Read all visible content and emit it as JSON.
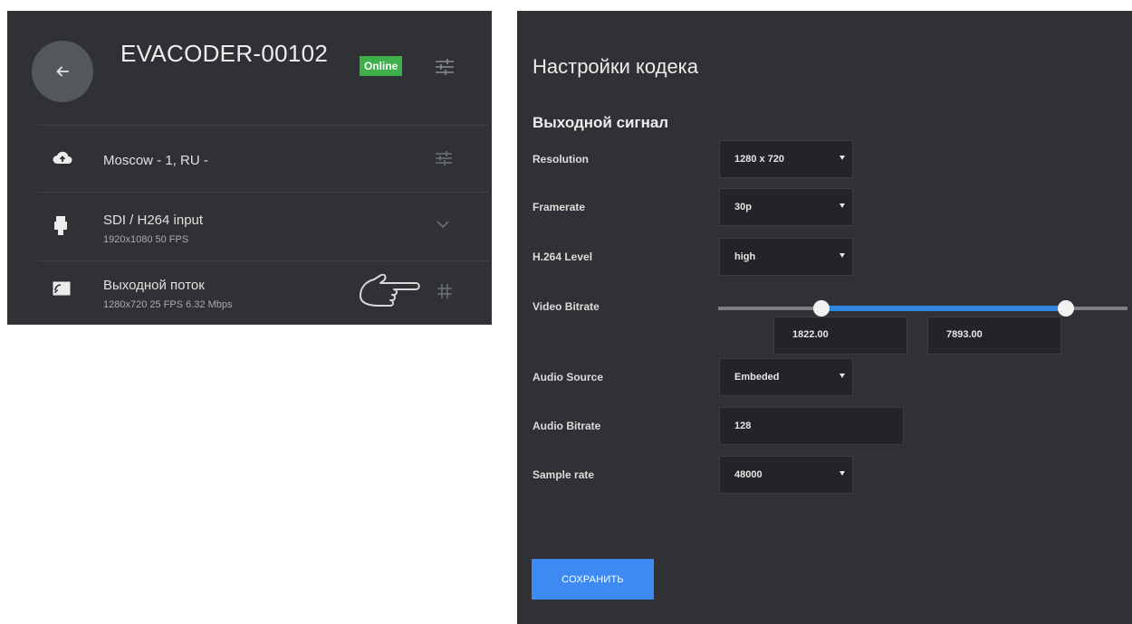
{
  "device": {
    "title": "EVACODER-00102",
    "status": "Online",
    "status_color": "#3db04b"
  },
  "rows": [
    {
      "icon": "cloud-upload-icon",
      "label": "Moscow - 1, RU  -",
      "sub": ""
    },
    {
      "icon": "sdi-connector-icon",
      "label": "SDI / H264 input",
      "sub": "1920x1080 50 FPS"
    },
    {
      "icon": "cast-icon",
      "label": "Выходной поток",
      "sub": "1280x720 25 FPS 6.32 Mbps"
    }
  ],
  "codec": {
    "title": "Настройки кодека",
    "section": "Выходной сигнал",
    "resolution": {
      "label": "Resolution",
      "value": "1280 x 720"
    },
    "framerate": {
      "label": "Framerate",
      "value": "30p"
    },
    "h264_level": {
      "label": "H.264 Level",
      "value": "high"
    },
    "video_bitrate": {
      "label": "Video Bitrate",
      "min_value": "1822.00",
      "max_value": "7893.00",
      "min_fraction": 0.25,
      "max_fraction": 0.85
    },
    "audio_source": {
      "label": "Audio Source",
      "value": "Embeded"
    },
    "audio_bitrate": {
      "label": "Audio Bitrate",
      "value": "128"
    },
    "sample_rate": {
      "label": "Sample rate",
      "value": "48000"
    },
    "save_label": "СОХРАНИТЬ"
  },
  "colors": {
    "panel_bg": "#2f3134",
    "accent": "#3d8bf2",
    "slider_fill": "#2f86e0"
  }
}
